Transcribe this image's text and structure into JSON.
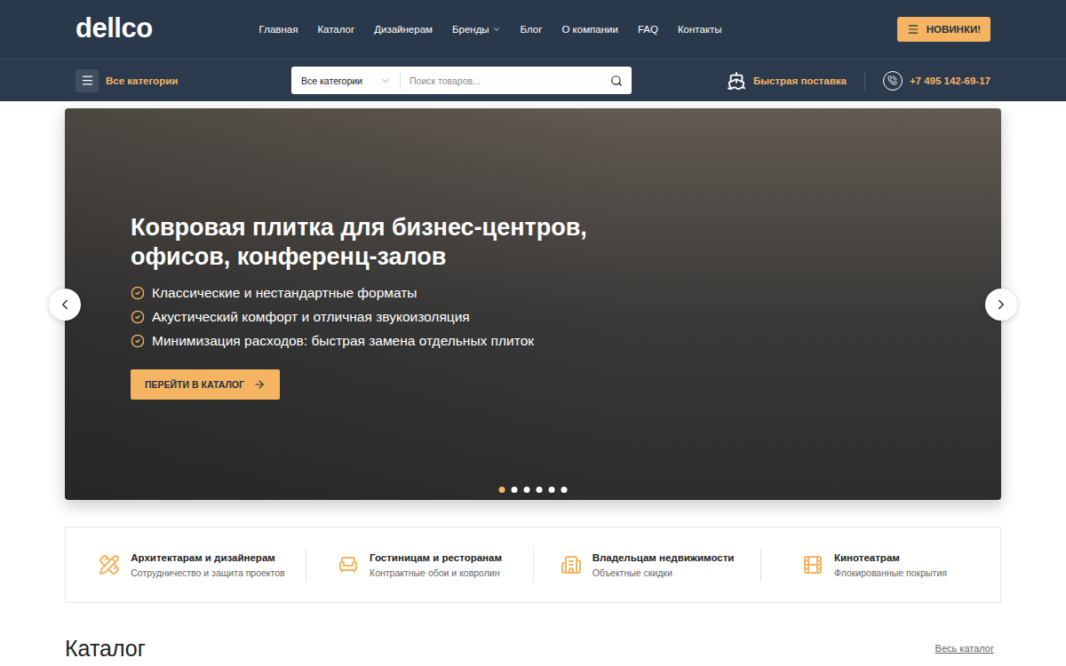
{
  "header": {
    "logo": "dellco",
    "nav": [
      {
        "label": "Главная",
        "dropdown": false
      },
      {
        "label": "Каталог",
        "dropdown": false
      },
      {
        "label": "Дизайнерам",
        "dropdown": false
      },
      {
        "label": "Бренды",
        "dropdown": true
      },
      {
        "label": "Блог",
        "dropdown": false
      },
      {
        "label": "О компании",
        "dropdown": false
      },
      {
        "label": "FAQ",
        "dropdown": false
      },
      {
        "label": "Контакты",
        "dropdown": false
      }
    ],
    "cta": "НОВИНКИ!"
  },
  "subbar": {
    "categories": "Все категории",
    "search": {
      "category": "Все категории",
      "placeholder": "Поиск товаров..."
    },
    "delivery": "Быстрая поставка",
    "phone": "+7 495 142-69-17"
  },
  "hero": {
    "title": [
      "Ковровая плитка для бизнес-центров,",
      "офисов, конференц-залов"
    ],
    "bullets": [
      "Классические и нестандартные форматы",
      "Акустический комфорт и отличная звукоизоляция",
      "Минимизация расходов: быстрая замена отдельных плиток"
    ],
    "button": "ПЕРЕЙТИ В КАТАЛОГ",
    "dots": [
      {
        "selected": true
      },
      {
        "selected": false
      },
      {
        "selected": false
      },
      {
        "selected": false
      },
      {
        "selected": false
      },
      {
        "selected": false
      }
    ]
  },
  "features": [
    {
      "title": "Архитектарам и дизайнерам",
      "subtitle": "Сотрудничество и защита проектов",
      "kind": "designers"
    },
    {
      "title": "Гостиницам и ресторанам",
      "subtitle": "Контрактные обои и ковролин",
      "kind": "hotels"
    },
    {
      "title": "Владельцам недвижимости",
      "subtitle": "Объектные скидки",
      "kind": "owners"
    },
    {
      "title": "Кинотеатрам",
      "subtitle": "Флокированные покрытия",
      "kind": "cinemas"
    }
  ],
  "catalog": {
    "title": "Каталог",
    "link": "Весь каталог"
  }
}
